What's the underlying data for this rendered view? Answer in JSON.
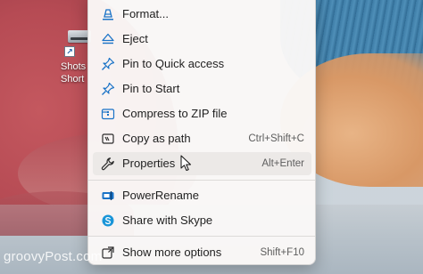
{
  "desktop": {
    "icon_label_line1": "Shots",
    "icon_label_line2": "Short",
    "shortcut_glyph": "↗",
    "watermark": "groovyPost.com"
  },
  "menu": {
    "items": [
      {
        "label": "Format...",
        "shortcut": "",
        "icon": "format-icon"
      },
      {
        "label": "Eject",
        "shortcut": "",
        "icon": "eject-icon"
      },
      {
        "label": "Pin to Quick access",
        "shortcut": "",
        "icon": "pin-icon"
      },
      {
        "label": "Pin to Start",
        "shortcut": "",
        "icon": "pin-icon"
      },
      {
        "label": "Compress to ZIP file",
        "shortcut": "",
        "icon": "zip-icon"
      },
      {
        "label": "Copy as path",
        "shortcut": "Ctrl+Shift+C",
        "icon": "copy-path-icon"
      },
      {
        "label": "Properties",
        "shortcut": "Alt+Enter",
        "icon": "wrench-icon",
        "highlighted": true
      },
      {
        "label": "PowerRename",
        "shortcut": "",
        "icon": "powerrename-icon"
      },
      {
        "label": "Share with Skype",
        "shortcut": "",
        "icon": "skype-icon"
      },
      {
        "label": "Show more options",
        "shortcut": "Shift+F10",
        "icon": "more-options-icon"
      }
    ]
  },
  "colors": {
    "accent_blue": "#1a73c7",
    "menu_bg": "#faf8f7",
    "hover_bg": "#ece9e7"
  }
}
